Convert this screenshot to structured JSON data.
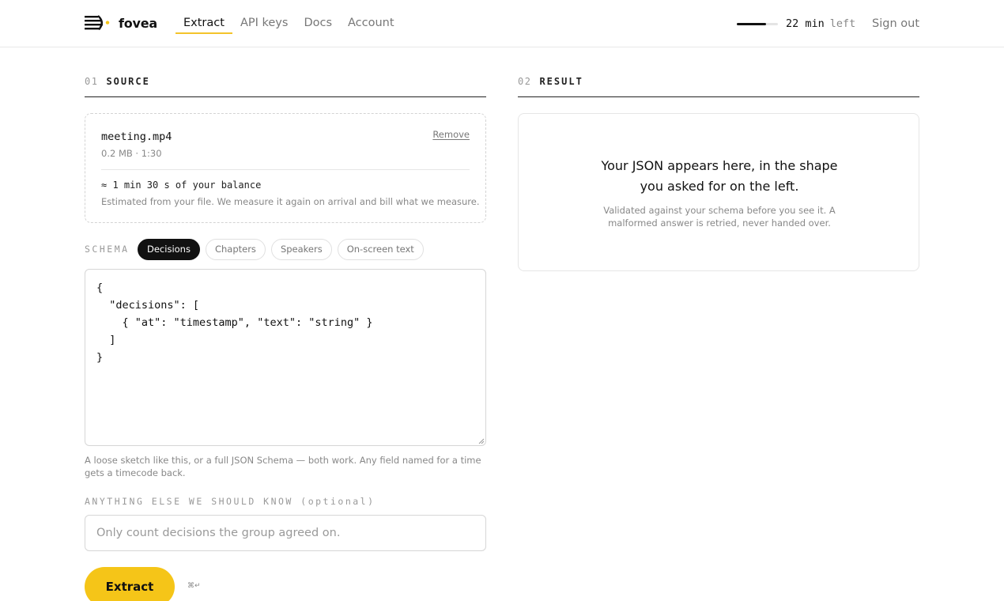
{
  "header": {
    "brand": "fovea",
    "nav": [
      {
        "label": "Extract",
        "active": true
      },
      {
        "label": "API keys",
        "active": false
      },
      {
        "label": "Docs",
        "active": false
      },
      {
        "label": "Account",
        "active": false
      }
    ],
    "balance": {
      "amount": "22 min",
      "suffix": "left",
      "fraction": 0.72
    },
    "sign_out": "Sign out"
  },
  "source": {
    "number": "01",
    "title": "SOURCE",
    "file": {
      "name": "meeting.mp4",
      "meta": "0.2 MB · 1:30",
      "remove_label": "Remove"
    },
    "estimate": "≈ 1 min 30 s of your balance",
    "estimate_note": "Estimated from your file. We measure it again on arrival and bill what we measure."
  },
  "schema": {
    "label": "SCHEMA",
    "presets": [
      {
        "label": "Decisions",
        "active": true
      },
      {
        "label": "Chapters",
        "active": false
      },
      {
        "label": "Speakers",
        "active": false
      },
      {
        "label": "On-screen text",
        "active": false
      }
    ],
    "value": "{\n  \"decisions\": [\n    { \"at\": \"timestamp\", \"text\": \"string\" }\n  ]\n}",
    "help": "A loose sketch like this, or a full JSON Schema — both work. Any field named for a time gets a timecode back."
  },
  "notes": {
    "label": "ANYTHING ELSE WE SHOULD KNOW (optional)",
    "placeholder": "Only count decisions the group agreed on.",
    "value": ""
  },
  "actions": {
    "extract_label": "Extract",
    "shortcut": "⌘↵"
  },
  "result": {
    "number": "02",
    "title": "RESULT",
    "empty_title": "Your JSON appears here, in the shape you asked for on the left.",
    "empty_note": "Validated against your schema before you see it. A malformed answer is retried, never handed over."
  },
  "colors": {
    "accent": "#f5c518",
    "text": "#111111",
    "muted": "#888888"
  },
  "icons": {
    "brand": "fovea-logo-icon",
    "resize": "resize-grip-icon"
  }
}
